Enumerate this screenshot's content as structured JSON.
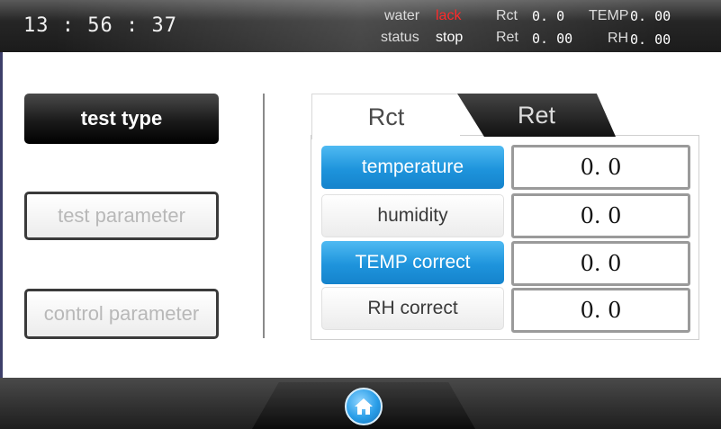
{
  "header": {
    "clock": "13 : 56 : 37",
    "water_label": "water",
    "water_value": "lack",
    "status_label": "status",
    "status_value": "stop",
    "rct_label": "Rct",
    "rct_value": "0. 0",
    "ret_label": "Ret",
    "ret_value": "0. 00",
    "temp_label": "TEMP",
    "temp_value": "0. 00",
    "rh_label": "RH",
    "rh_value": "0. 00"
  },
  "nav": {
    "test_type": "test type",
    "test_parameter": "test parameter",
    "control_parameter": "control parameter"
  },
  "tabs": {
    "rct": "Rct",
    "ret": "Ret"
  },
  "rows": [
    {
      "label": "temperature",
      "value": "0. 0"
    },
    {
      "label": "humidity",
      "value": "0. 0"
    },
    {
      "label": "TEMP correct",
      "value": "0. 0"
    },
    {
      "label": "RH correct",
      "value": "0. 0"
    }
  ],
  "footer": {
    "home_icon": "home-icon"
  },
  "colors": {
    "accent_blue": "#1e94dc",
    "alert_red": "#ff2a2a"
  }
}
